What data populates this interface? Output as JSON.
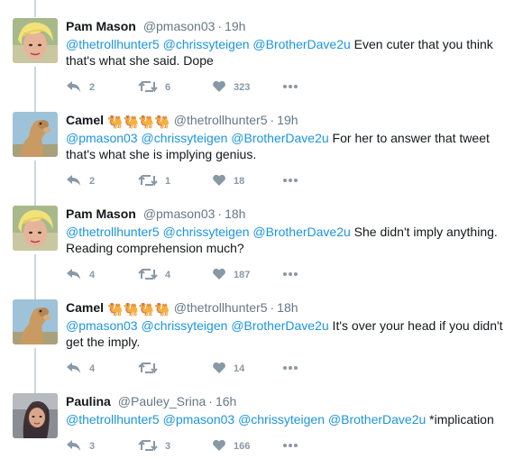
{
  "tweets": [
    {
      "name": "Pam Mason",
      "emoji": "",
      "handle": "@pmason03",
      "time": "19h",
      "mentions": "@thetrollhunter5 @chrissyteigen @BrotherDave2u",
      "text": " Even cuter that you think that's what she said. Dope",
      "replies": "2",
      "retweets": "6",
      "likes": "323",
      "avatar": "pam"
    },
    {
      "name": "Camel",
      "emoji": "🐫🐫🐫🐫",
      "handle": "@thetrollhunter5",
      "time": "19h",
      "mentions": "@pmason03 @chrissyteigen @BrotherDave2u",
      "text": " For her to answer that tweet that's what she is implying genius.",
      "replies": "2",
      "retweets": "1",
      "likes": "18",
      "avatar": "camel"
    },
    {
      "name": "Pam Mason",
      "emoji": "",
      "handle": "@pmason03",
      "time": "18h",
      "mentions": "@thetrollhunter5 @chrissyteigen @BrotherDave2u",
      "text": " She didn't imply anything. Reading comprehension much?",
      "replies": "4",
      "retweets": "4",
      "likes": "187",
      "avatar": "pam"
    },
    {
      "name": "Camel",
      "emoji": "🐫🐫🐫🐫",
      "handle": "@thetrollhunter5",
      "time": "18h",
      "mentions": "@pmason03 @chrissyteigen @BrotherDave2u",
      "text": " It's over your head if you didn't get the imply.",
      "replies": "4",
      "retweets": "",
      "likes": "14",
      "avatar": "camel"
    },
    {
      "name": "Paulina",
      "emoji": "",
      "handle": "@Pauley_Srina",
      "time": "16h",
      "mentions": "@thetrollhunter5 @pmason03 @chrissyteigen @BrotherDave2u",
      "text": " *implication",
      "replies": "3",
      "retweets": "3",
      "likes": "166",
      "avatar": "paulina"
    }
  ],
  "ui": {
    "time_separator": "·",
    "more_icon": "more-icon",
    "reply_icon": "reply-icon",
    "retweet_icon": "retweet-icon",
    "like_icon": "heart-icon"
  },
  "colors": {
    "mention": "#1b95e0",
    "muted": "#657786",
    "action": "#8899a6",
    "thread_line": "#ccd6dd"
  }
}
